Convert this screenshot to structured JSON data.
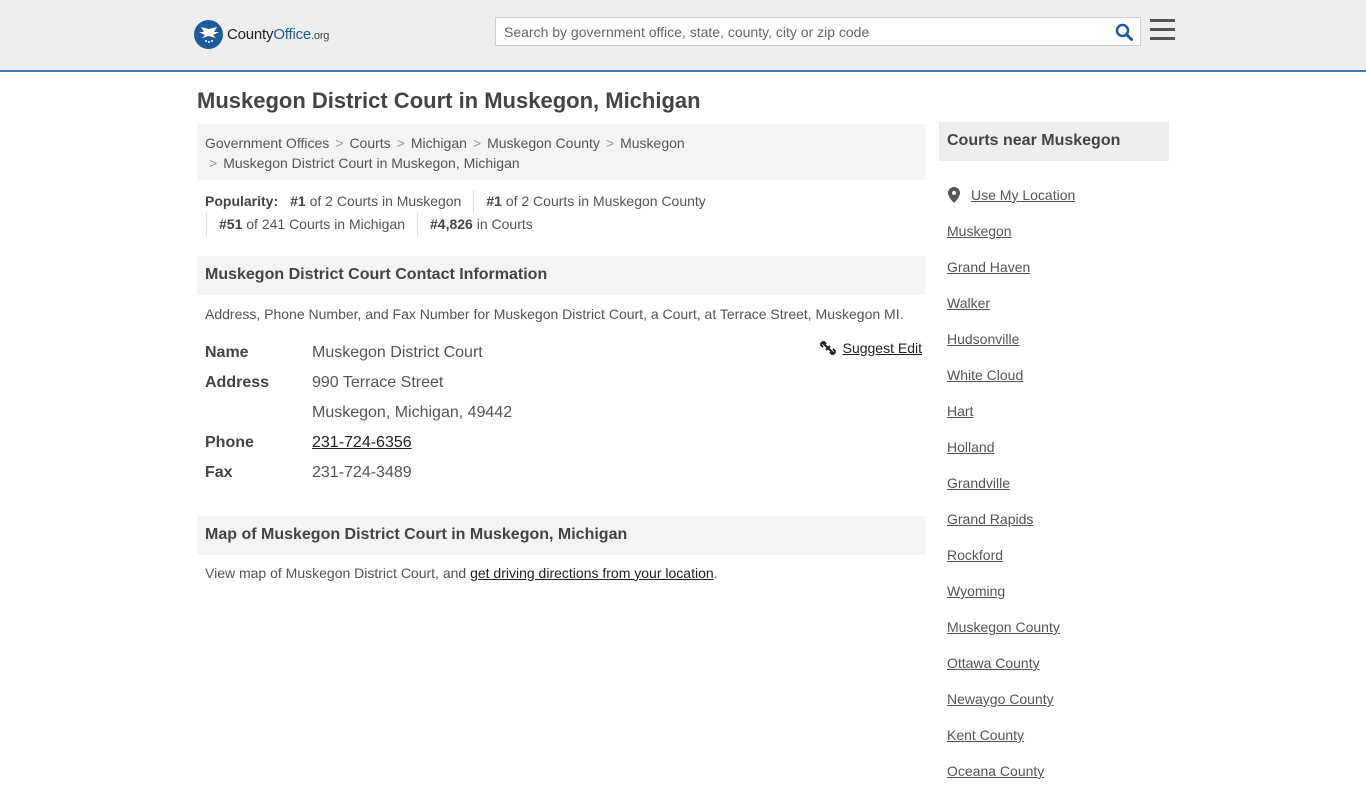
{
  "header": {
    "logo_text_1": "County",
    "logo_text_2": "Office",
    "logo_tld": ".org",
    "search_placeholder": "Search by government office, state, county, city or zip code"
  },
  "page_title": "Muskegon District Court in Muskegon, Michigan",
  "breadcrumbs": [
    "Government Offices",
    "Courts",
    "Michigan",
    "Muskegon County",
    "Muskegon",
    "Muskegon District Court in Muskegon, Michigan"
  ],
  "popularity": {
    "label": "Popularity:",
    "items": [
      {
        "rank": "#1",
        "text": "of 2 Courts in Muskegon"
      },
      {
        "rank": "#1",
        "text": "of 2 Courts in Muskegon County"
      },
      {
        "rank": "#51",
        "text": "of 241 Courts in Michigan"
      },
      {
        "rank": "#4,826",
        "text": "in Courts"
      }
    ]
  },
  "contact": {
    "heading": "Muskegon District Court Contact Information",
    "description": "Address, Phone Number, and Fax Number for Muskegon District Court, a Court, at Terrace Street, Muskegon MI.",
    "suggest_edit": "Suggest Edit",
    "name_label": "Name",
    "name_value": "Muskegon District Court",
    "address_label": "Address",
    "address_line1": "990 Terrace Street",
    "address_line2": "Muskegon, Michigan, 49442",
    "phone_label": "Phone",
    "phone_value": "231-724-6356",
    "fax_label": "Fax",
    "fax_value": "231-724-3489"
  },
  "map": {
    "heading": "Map of Muskegon District Court in Muskegon, Michigan",
    "text_before": "View map of Muskegon District Court, and ",
    "link_text": "get driving directions from your location",
    "text_after": "."
  },
  "sidebar": {
    "heading": "Courts near Muskegon",
    "use_location": "Use My Location",
    "items": [
      "Muskegon",
      "Grand Haven",
      "Walker",
      "Hudsonville",
      "White Cloud",
      "Hart",
      "Holland",
      "Grandville",
      "Grand Rapids",
      "Rockford",
      "Wyoming",
      "Muskegon County",
      "Ottawa County",
      "Newaygo County",
      "Kent County",
      "Oceana County"
    ]
  },
  "colors": {
    "accent": "#1f5b9a",
    "header_bg": "#eeeeee",
    "section_bg": "#f4f4f4"
  }
}
